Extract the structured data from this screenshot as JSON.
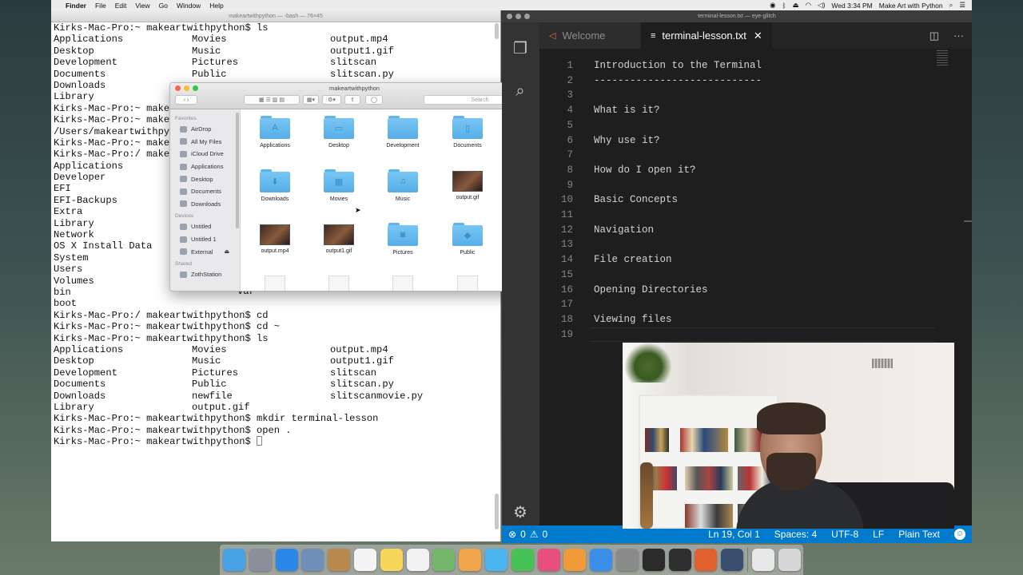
{
  "menubar": {
    "apple": "",
    "menus": [
      "Finder",
      "File",
      "Edit",
      "View",
      "Go",
      "Window",
      "Help"
    ],
    "clock": "Wed 3:34 PM",
    "user": "Make Art with Python"
  },
  "terminal": {
    "title": "makeartwithpython — -bash — 76×45",
    "lines": [
      {
        "type": "text",
        "text": "Kirks-Mac-Pro:~ makeartwithpython$ ls"
      },
      {
        "type": "cols",
        "cols": [
          "Applications",
          "Movies",
          "output.mp4"
        ]
      },
      {
        "type": "cols",
        "cols": [
          "Desktop",
          "Music",
          "output1.gif"
        ]
      },
      {
        "type": "cols",
        "cols": [
          "Development",
          "Pictures",
          "slitscan"
        ]
      },
      {
        "type": "cols",
        "cols": [
          "Documents",
          "Public",
          "slitscan.py"
        ]
      },
      {
        "type": "cols",
        "cols": [
          "Downloads",
          "",
          ""
        ]
      },
      {
        "type": "text",
        "text": "Library"
      },
      {
        "type": "text",
        "text": "Kirks-Mac-Pro:~ makeartwithpython$ cd"
      },
      {
        "type": "text",
        "text": "Kirks-Mac-Pro:~ make"
      },
      {
        "type": "text",
        "text": "/Users/makeartwithpy"
      },
      {
        "type": "text",
        "text": "Kirks-Mac-Pro:~ make"
      },
      {
        "type": "text",
        "text": "Kirks-Mac-Pro:/ make"
      },
      {
        "type": "text",
        "text": "Applications"
      },
      {
        "type": "text",
        "text": "Developer"
      },
      {
        "type": "text",
        "text": "EFI"
      },
      {
        "type": "text",
        "text": "EFI-Backups"
      },
      {
        "type": "text",
        "text": "Extra"
      },
      {
        "type": "text",
        "text": "Library"
      },
      {
        "type": "text",
        "text": "Network"
      },
      {
        "type": "text",
        "text": "OS X Install Data"
      },
      {
        "type": "text",
        "text": "System"
      },
      {
        "type": "text",
        "text": "Users"
      },
      {
        "type": "text",
        "text": "Volumes"
      },
      {
        "type": "cols",
        "cols": [
          "bin",
          "",
          ""
        ]
      },
      {
        "type": "text",
        "text": "boot"
      },
      {
        "type": "text",
        "text": "Kirks-Mac-Pro:/ makeartwithpython$ cd"
      },
      {
        "type": "text",
        "text": "Kirks-Mac-Pro:~ makeartwithpython$ cd ~"
      },
      {
        "type": "text",
        "text": "Kirks-Mac-Pro:~ makeartwithpython$ ls"
      },
      {
        "type": "cols",
        "cols": [
          "Applications",
          "Movies",
          "output.mp4"
        ]
      },
      {
        "type": "cols",
        "cols": [
          "Desktop",
          "Music",
          "output1.gif"
        ]
      },
      {
        "type": "cols",
        "cols": [
          "Development",
          "Pictures",
          "slitscan"
        ]
      },
      {
        "type": "cols",
        "cols": [
          "Documents",
          "Public",
          "slitscan.py"
        ]
      },
      {
        "type": "cols",
        "cols": [
          "Downloads",
          "newfile",
          "slitscanmovie.py"
        ]
      },
      {
        "type": "cols",
        "cols": [
          "Library",
          "output.gif",
          ""
        ]
      },
      {
        "type": "text",
        "text": "Kirks-Mac-Pro:~ makeartwithpython$ mkdir terminal-lesson"
      },
      {
        "type": "text",
        "text": "Kirks-Mac-Pro:~ makeartwithpython$ open ."
      },
      {
        "type": "prompt",
        "text": "Kirks-Mac-Pro:~ makeartwithpython$ "
      }
    ],
    "partial_var": "var"
  },
  "finder": {
    "title": "makeartwithpython",
    "search_placeholder": "Search",
    "sidebar": [
      {
        "header": "Favorites",
        "items": [
          "AirDrop",
          "All My Files",
          "iCloud Drive",
          "Applications",
          "Desktop",
          "Documents",
          "Downloads"
        ]
      },
      {
        "header": "Devices",
        "items": [
          "Untitled",
          "Untitled 1",
          "External"
        ]
      },
      {
        "header": "Shared",
        "items": [
          "ZothStation"
        ]
      }
    ],
    "items": [
      {
        "name": "Applications",
        "kind": "folder",
        "glyph": "A"
      },
      {
        "name": "Desktop",
        "kind": "folder",
        "glyph": "▭"
      },
      {
        "name": "Development",
        "kind": "folder",
        "glyph": ""
      },
      {
        "name": "Documents",
        "kind": "folder",
        "glyph": "▯"
      },
      {
        "name": "Downloads",
        "kind": "folder",
        "glyph": "⬇"
      },
      {
        "name": "Movies",
        "kind": "folder",
        "glyph": "▦"
      },
      {
        "name": "Music",
        "kind": "folder",
        "glyph": "♫"
      },
      {
        "name": "output.gif",
        "kind": "image",
        "glyph": ""
      },
      {
        "name": "output.mp4",
        "kind": "image",
        "glyph": ""
      },
      {
        "name": "output1.gif",
        "kind": "image",
        "glyph": ""
      },
      {
        "name": "Pictures",
        "kind": "folder",
        "glyph": "◙"
      },
      {
        "name": "Public",
        "kind": "folder",
        "glyph": "◆"
      },
      {
        "name": "",
        "kind": "doc",
        "glyph": ""
      },
      {
        "name": "",
        "kind": "doc",
        "glyph": ""
      },
      {
        "name": "",
        "kind": "doc",
        "glyph": ""
      },
      {
        "name": "",
        "kind": "doc",
        "glyph": ""
      }
    ]
  },
  "vscode": {
    "title": "terminal-lesson.txt — eye-glitch",
    "tabs": [
      {
        "label": "Welcome",
        "icon": "vscode-logo-icon",
        "active": false
      },
      {
        "label": "terminal-lesson.txt",
        "icon": "file-lines-icon",
        "active": true
      }
    ],
    "lines": [
      "Introduction to the Terminal",
      "----------------------------",
      "",
      "What is it?",
      "",
      "Why use it?",
      "",
      "How do I open it?",
      "",
      "Basic Concepts",
      "",
      "Navigation",
      "",
      "File creation",
      "",
      "Opening Directories",
      "",
      "Viewing files",
      ""
    ],
    "line_numbers": [
      "1",
      "2",
      "3",
      "4",
      "5",
      "6",
      "7",
      "8",
      "9",
      "10",
      "11",
      "12",
      "13",
      "14",
      "15",
      "16",
      "17",
      "18",
      "19"
    ],
    "status": {
      "errors": "0",
      "warnings": "0",
      "position": "Ln 19, Col 1",
      "spaces": "Spaces: 4",
      "encoding": "UTF-8",
      "eol": "LF",
      "language": "Plain Text"
    },
    "colors": {
      "statusbar": "#007acc",
      "editor_bg": "#1e1e1e",
      "activity_bg": "#333333"
    }
  },
  "dock": {
    "apps": [
      {
        "name": "finder",
        "color": "#4aa2e6"
      },
      {
        "name": "launchpad",
        "color": "#8a8f99"
      },
      {
        "name": "safari",
        "color": "#2c88e8"
      },
      {
        "name": "preview",
        "color": "#6f8fb8"
      },
      {
        "name": "contacts",
        "color": "#b98a50"
      },
      {
        "name": "calendar",
        "color": "#f4f4f4"
      },
      {
        "name": "notes",
        "color": "#f6d75a"
      },
      {
        "name": "reminders",
        "color": "#f2f2f2"
      },
      {
        "name": "maps",
        "color": "#74b66a"
      },
      {
        "name": "photos",
        "color": "#f1a64d"
      },
      {
        "name": "messages",
        "color": "#4ab5f0"
      },
      {
        "name": "facetime",
        "color": "#46c256"
      },
      {
        "name": "itunes",
        "color": "#e84e80"
      },
      {
        "name": "ibooks",
        "color": "#f09a38"
      },
      {
        "name": "app-store",
        "color": "#3c8fe8"
      },
      {
        "name": "system-preferences",
        "color": "#8a8a8a"
      },
      {
        "name": "terminal",
        "color": "#2b2b2b"
      },
      {
        "name": "visual-studio-code",
        "color": "#2f2f2f"
      },
      {
        "name": "firefox",
        "color": "#e2602e"
      },
      {
        "name": "quicktime",
        "color": "#3a4f6f"
      }
    ],
    "trailing": [
      {
        "name": "document-stack",
        "color": "#e8e8e8"
      },
      {
        "name": "trash",
        "color": "#d6d6d6"
      }
    ]
  }
}
